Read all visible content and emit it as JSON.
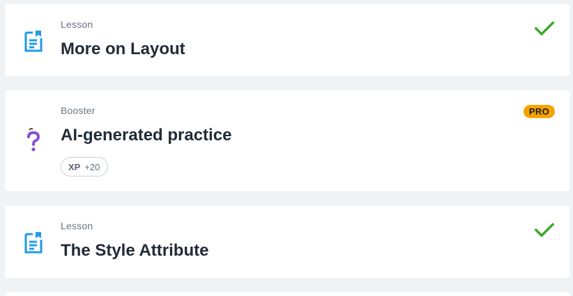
{
  "colors": {
    "background": "#f0f3f6",
    "card": "#ffffff",
    "lesson_icon": "#1e9be9",
    "booster_icon": "#8a4fd8",
    "check": "#3caa2a",
    "pro_badge": "#f6a300"
  },
  "items": [
    {
      "type": "Lesson",
      "title": "More on Layout",
      "icon": "lesson-document-icon",
      "status": "completed"
    },
    {
      "type": "Booster",
      "title": "AI-generated practice",
      "icon": "question-mark-icon",
      "badge": "PRO",
      "xp": {
        "label": "XP",
        "value": "+20"
      }
    },
    {
      "type": "Lesson",
      "title": "The Style Attribute",
      "icon": "lesson-document-icon",
      "status": "completed"
    }
  ]
}
